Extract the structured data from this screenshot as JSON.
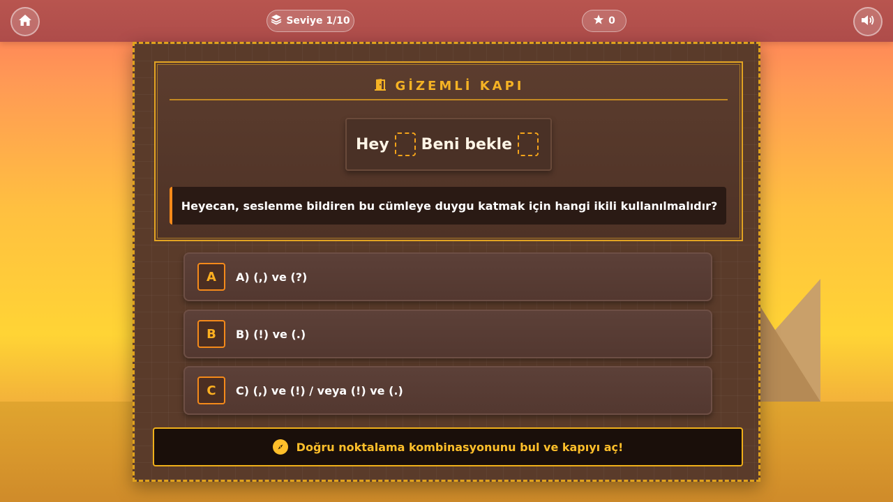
{
  "topbar": {
    "level_label": "Seviye 1/10",
    "score": "0"
  },
  "door": {
    "title": "GİZEMLİ KAPI",
    "sentence_part1": "Hey",
    "sentence_part2": "Beni bekle",
    "question": "Heyecan, seslenme bildiren bu cümleye duygu katmak için hangi ikili kullanılmalıdır?"
  },
  "options": [
    {
      "letter": "A",
      "text": "A) (,) ve (?)"
    },
    {
      "letter": "B",
      "text": "B) (!) ve (.)"
    },
    {
      "letter": "C",
      "text": "C) (,) ve (!) / veya (!) ve (.)"
    }
  ],
  "hint": "Doğru noktalama kombinasyonunu bul ve kapıyı aç!",
  "colors": {
    "topbar": "#ae4c4a",
    "panel": "#5a3b2a",
    "accent": "#f5b324",
    "option_border": "#f58a1a"
  }
}
